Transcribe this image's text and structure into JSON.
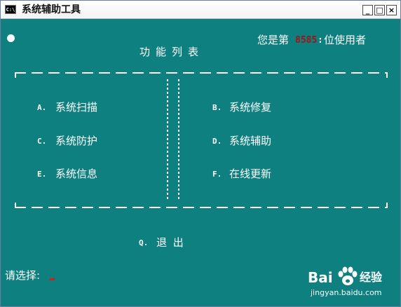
{
  "window": {
    "icon_text": "C:\\",
    "title": "系统辅助工具",
    "minimize_glyph": "_",
    "maximize_glyph": "□",
    "close_glyph": "×"
  },
  "counter": {
    "prefix": "您是第",
    "value": "8585",
    "colon": ":",
    "suffix": "位使用者",
    "value_color": "#a11212"
  },
  "menu": {
    "title": "功能列表",
    "left": [
      {
        "key": "A.",
        "label": "系统扫描"
      },
      {
        "key": "C.",
        "label": "系统防护"
      },
      {
        "key": "E.",
        "label": "系统信息"
      }
    ],
    "right": [
      {
        "key": "B.",
        "label": "系统修复"
      },
      {
        "key": "D.",
        "label": "系统辅助"
      },
      {
        "key": "F.",
        "label": "在线更新"
      }
    ],
    "quit": {
      "key": "Q.",
      "label": "退 出"
    }
  },
  "prompt": {
    "label": "请选择:"
  },
  "watermark": {
    "brand": "Bai",
    "product": "经验",
    "url": "jingyan.baidu.com"
  },
  "colors": {
    "console_background": "#0f8080",
    "text": "#ffffff",
    "cursor": "#cc2222"
  }
}
